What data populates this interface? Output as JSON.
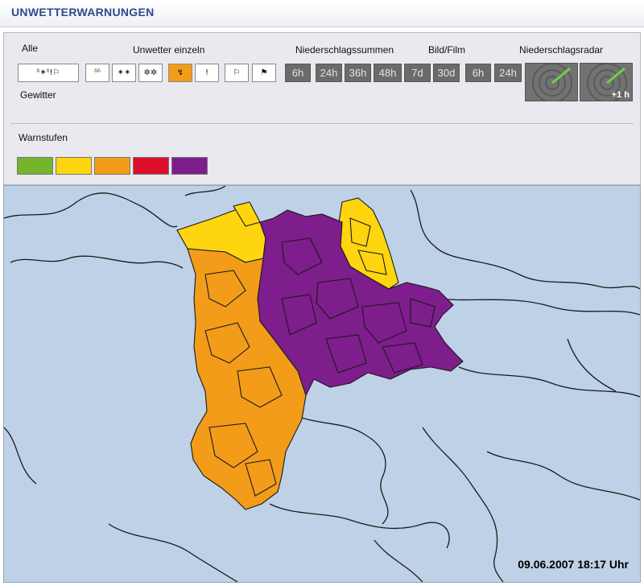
{
  "header": {
    "title": "UNWETTERWARNUNGEN"
  },
  "controls": {
    "alle_label": "Alle",
    "einzeln_label": "Unwetter einzeln",
    "summen_label": "Niederschlagssummen",
    "bildfilm_label": "Bild/Film",
    "radar_label": "Niederschlagsradar",
    "gewitter_label": "Gewitter",
    "alle_icons": "ᵟ✶ᵟ!⚐",
    "icons": [
      {
        "name": "rain-drops-icon",
        "glyph": "ᵟᵟ",
        "active": false
      },
      {
        "name": "snow-icon",
        "glyph": "✶✶",
        "active": false
      },
      {
        "name": "snow-drift-icon",
        "glyph": "✲✲",
        "active": false
      },
      {
        "name": "thunderstorm-icon",
        "glyph": "↯",
        "active": true
      },
      {
        "name": "black-ice-icon",
        "glyph": "!",
        "active": false
      },
      {
        "name": "wind-flag-icon",
        "glyph": "⚐",
        "active": false
      },
      {
        "name": "storm-flag-icon",
        "glyph": "⚑",
        "active": false
      }
    ],
    "summen_times": [
      "6h",
      "24h",
      "36h",
      "48h",
      "7d",
      "30d"
    ],
    "bildfilm_times": [
      "6h",
      "24h"
    ],
    "radar_tag": "+1 h"
  },
  "legend": {
    "title": "Warnstufen",
    "colors": [
      "#74b52b",
      "#ffd510",
      "#f39c1a",
      "#dd0f2c",
      "#7e1d8c"
    ]
  },
  "map": {
    "background": "#bed1e6",
    "border_color": "#1a1a1a",
    "timestamp": "09.06.2007 18:17 Uhr"
  }
}
